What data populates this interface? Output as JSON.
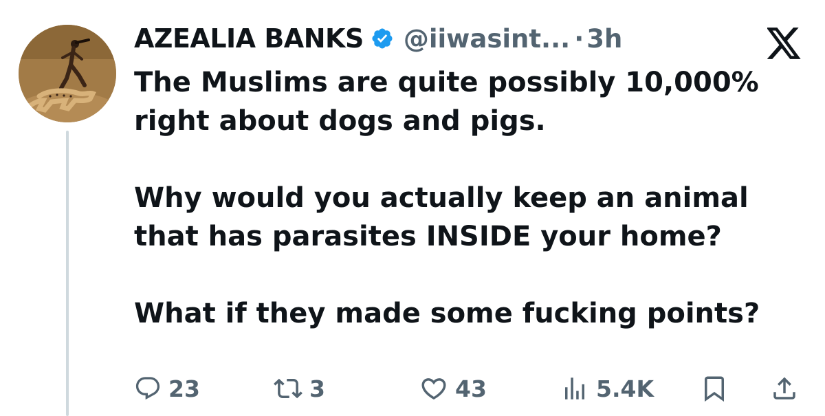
{
  "author": {
    "display_name": "AZEALIA BANKS",
    "handle": "@iiwasint...",
    "separator": "·",
    "time": "3h",
    "verified": true
  },
  "platform_icon": "x-logo-icon",
  "tweet": {
    "paragraphs": [
      "The Muslims are quite possibly 10,000% right about dogs and pigs.",
      "Why would you actually keep an animal that has parasites INSIDE your home?",
      "What if they made some fucking points?"
    ]
  },
  "actions": {
    "replies": "23",
    "reposts": "3",
    "likes": "43",
    "views": "5.4K"
  },
  "colors": {
    "text": "#0f1419",
    "secondary": "#536471",
    "verified_blue": "#1d9bf0",
    "thread_line": "#cfd9de"
  }
}
